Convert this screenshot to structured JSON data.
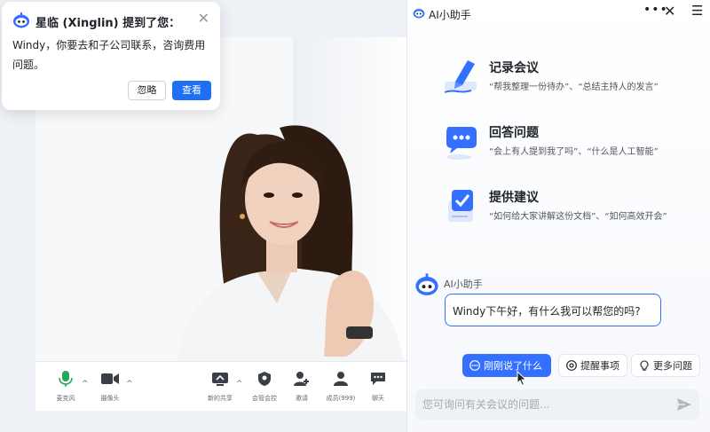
{
  "notification": {
    "title": "星临 (Xinglin) 提到了您：",
    "body": "Windy，你要去和子公司联系，咨询费用问题。",
    "close_icon": "close-icon",
    "ignore_label": "忽略",
    "view_label": "查看"
  },
  "toolbar": {
    "items": [
      {
        "label": "麦克风",
        "icon": "microphone-icon"
      },
      {
        "label": "摄像头",
        "icon": "camera-icon"
      },
      {
        "label": "新的共享",
        "icon": "share-screen-icon"
      },
      {
        "label": "会管会控",
        "icon": "host-controls-icon"
      },
      {
        "label": "邀请",
        "icon": "invite-icon"
      },
      {
        "label": "成员(999)",
        "icon": "participants-icon"
      },
      {
        "label": "聊天",
        "icon": "chat-icon"
      }
    ]
  },
  "panel": {
    "title": "AI小助手",
    "features": [
      {
        "title": "记录会议",
        "subtitle": "“帮我整理一份待办”、“总结主持人的发言”",
        "icon": "pen-notes-icon"
      },
      {
        "title": "回答问题",
        "subtitle": "“会上有人提到我了吗”、“什么是人工智能”",
        "icon": "chat-bubble-icon"
      },
      {
        "title": "提供建议",
        "subtitle": "“如何给大家讲解这份文档”、“如何高效开会”",
        "icon": "checkbox-doc-icon"
      }
    ],
    "assistant_name": "AI小助手",
    "greeting": "Windy下午好，有什么我可以帮您的吗?",
    "chips": [
      {
        "label": "刚刚说了什么",
        "icon": "chat-dots-icon"
      },
      {
        "label": "提醒事项",
        "icon": "at-icon"
      },
      {
        "label": "更多问题",
        "icon": "lightbulb-icon"
      }
    ],
    "input_placeholder": "您可询问有关会议的问题..."
  },
  "colors": {
    "accent": "#3370ff",
    "primary_button": "#1f6ff5"
  }
}
